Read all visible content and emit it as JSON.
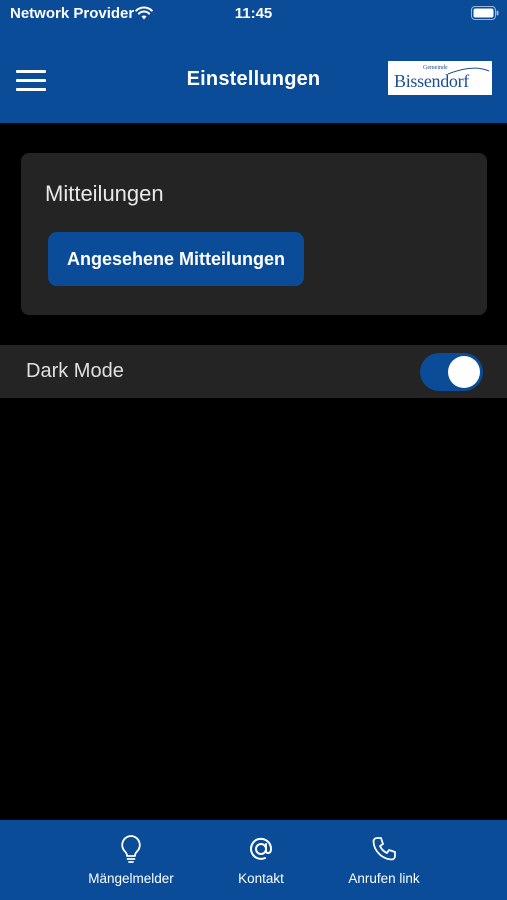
{
  "status_bar": {
    "carrier": "Network Provider",
    "time": "11:45"
  },
  "header": {
    "title": "Einstellungen",
    "logo": {
      "small_text": "Gemeinde",
      "name": "Bissendorf"
    }
  },
  "notifications_card": {
    "title": "Mitteilungen",
    "button_label": "Angesehene Mitteilungen"
  },
  "settings": {
    "dark_mode_label": "Dark Mode",
    "dark_mode_on": true
  },
  "tabbar": {
    "items": [
      {
        "label": "Mängelmelder",
        "icon": "lightbulb-icon"
      },
      {
        "label": "Kontakt",
        "icon": "at-icon"
      },
      {
        "label": "Anrufen link",
        "icon": "phone-icon"
      }
    ]
  },
  "colors": {
    "primary": "#0a4c98",
    "background": "#000000",
    "surface": "#242424"
  }
}
